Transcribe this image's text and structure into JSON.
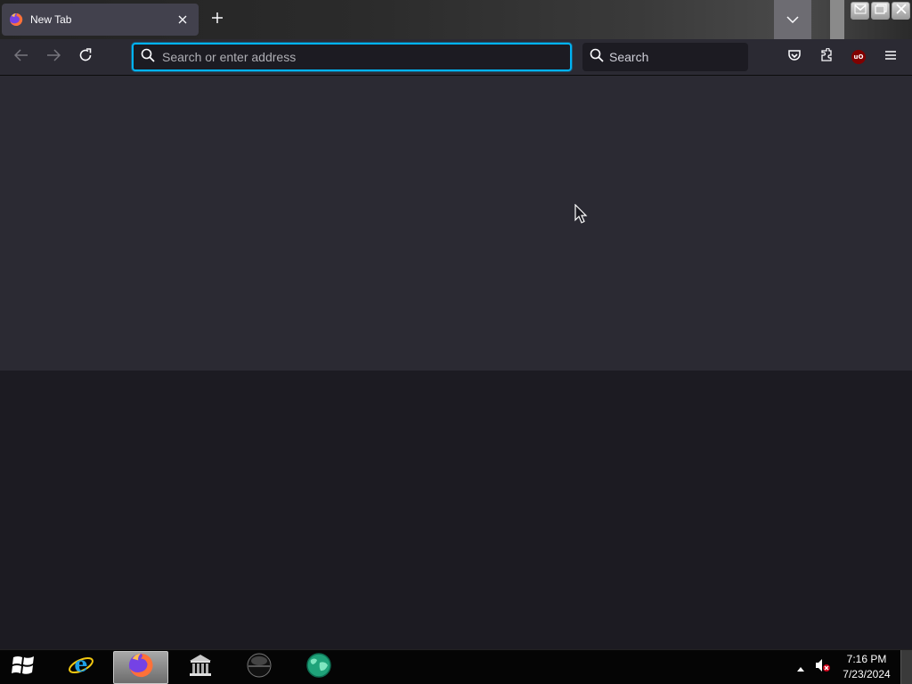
{
  "browser": {
    "tab": {
      "title": "New Tab",
      "favicon": "firefox-icon",
      "close_icon": "close-icon"
    },
    "new_tab_icon": "plus-icon",
    "tab_list_icon": "chevron-down-icon",
    "window_controls": [
      "minimize-icon",
      "maximize-icon",
      "close-icon"
    ],
    "nav": {
      "back_icon": "back-arrow-icon",
      "forward_icon": "forward-arrow-icon",
      "reload_icon": "reload-icon"
    },
    "urlbar": {
      "placeholder": "Search or enter address",
      "value": "",
      "focused": true
    },
    "searchbar": {
      "placeholder": "Search"
    },
    "toolbar_icons": [
      "pocket-icon",
      "extensions-icon",
      "ublock-origin-icon",
      "hamburger-menu-icon"
    ],
    "ublock_badge": "uO"
  },
  "taskbar": {
    "start_icon": "windows-logo-icon",
    "items": [
      {
        "name": "internet-explorer",
        "icon": "internet-explorer-icon",
        "active": false
      },
      {
        "name": "firefox",
        "icon": "firefox-icon",
        "active": true
      },
      {
        "name": "library",
        "icon": "library-building-icon",
        "active": false
      },
      {
        "name": "media-player",
        "icon": "black-orb-icon",
        "active": false
      },
      {
        "name": "globe-app",
        "icon": "green-globe-icon",
        "active": false
      }
    ],
    "tray": {
      "arrow_icon": "tray-up-arrow-icon",
      "volume_icon": "volume-muted-icon"
    },
    "clock": {
      "time": "7:16 PM",
      "date": "7/23/2024"
    }
  },
  "colors": {
    "accent_focus": "#00b3f4",
    "toolbar": "#2b2a33",
    "content_top": "#2b2a33",
    "content_bottom": "#1c1b22",
    "tab_active": "#42414d"
  }
}
